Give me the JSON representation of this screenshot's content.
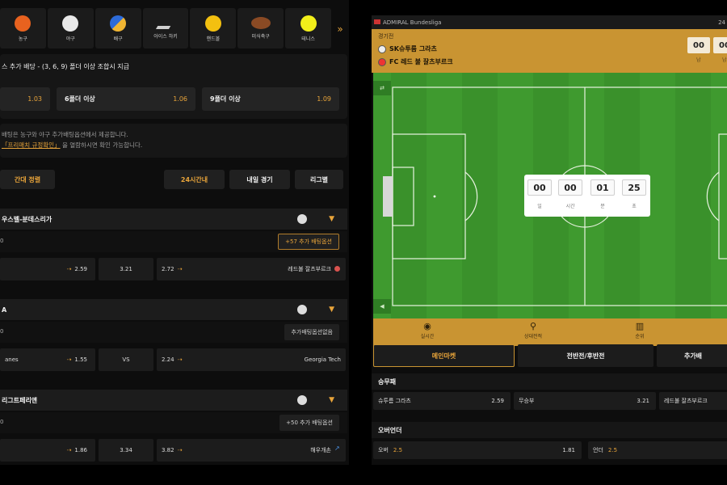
{
  "sports": [
    {
      "label": "농구",
      "icon": "basketball-icon",
      "color": "#e8621f"
    },
    {
      "label": "야구",
      "icon": "baseball-icon",
      "color": "#e9e9e9"
    },
    {
      "label": "배구",
      "icon": "volleyball-icon",
      "color": "#f0b532"
    },
    {
      "label": "아이스 하키",
      "icon": "hockey-stick-icon",
      "color": "#cfcfcf"
    },
    {
      "label": "핸드볼",
      "icon": "handball-icon",
      "color": "#f3c010"
    },
    {
      "label": "미식축구",
      "icon": "football-icon",
      "color": "#8a4a24"
    },
    {
      "label": "테니스",
      "icon": "tennis-ball-icon",
      "color": "#f2ef1a"
    }
  ],
  "sports_more": "»",
  "bonus": {
    "title": "스 추가 배당 - (3, 6, 9) 폴더 이상 조합시 지급",
    "items": [
      {
        "label": "",
        "value": "1.03"
      },
      {
        "label": "6폴더 이상",
        "value": "1.06"
      },
      {
        "label": "9폴더 이상",
        "value": "1.09"
      }
    ]
  },
  "notice": {
    "line1": "배팅은 농구와 야구 추가배팅옵션에서 제공합니다.",
    "link": "「프리매치 규정확인」",
    "line2_suffix": " 을 열람하시면 확인 가능합니다."
  },
  "sort": {
    "left": "간대 정렬",
    "buttons": [
      "24시간내",
      "내일 경기",
      "리그별"
    ]
  },
  "leagues": [
    {
      "name": "우스벨-분데스리가",
      "zero": "0",
      "extra": "+57 추가 배팅옵션",
      "home": "",
      "home_odds": "2.59",
      "draw": "3.21",
      "away_odds": "2.72",
      "away": "레드불 잘츠부르크"
    },
    {
      "name": "A",
      "zero": "0",
      "extra": "추가배팅옵션없음",
      "home": "anes",
      "home_odds": "1.55",
      "draw": "VS",
      "away_odds": "2.24",
      "away": "Georgia Tech"
    },
    {
      "name": "리그트페리앤",
      "zero": "0",
      "extra": "+50 추가 배팅옵션",
      "home": "",
      "home_odds": "1.86",
      "draw": "3.34",
      "away_odds": "3.82",
      "away": "해우개손"
    }
  ],
  "match": {
    "league": "ADMIRAL Bundesliga",
    "right_time": "24",
    "status": "경기전",
    "home": "SK슈투름 그라츠",
    "away": "FC 레드 불 잘츠부르크",
    "scores": [
      "00",
      "00"
    ],
    "score_labels": [
      "남",
      "남"
    ],
    "pitch_tabs": [
      "⇄",
      "◀"
    ],
    "timer": [
      {
        "value": "00",
        "label": "일"
      },
      {
        "value": "00",
        "label": "시간"
      },
      {
        "value": "01",
        "label": "분"
      },
      {
        "value": "25",
        "label": "초"
      }
    ],
    "view_tabs": [
      {
        "icon": "eye-icon",
        "glyph": "◉",
        "label": "실시간"
      },
      {
        "icon": "lineup-icon",
        "glyph": "⚲",
        "label": "상대전적"
      },
      {
        "icon": "stats-icon",
        "glyph": "▥",
        "label": "순위"
      }
    ],
    "market_tabs": [
      "메인마켓",
      "전반전/후반전",
      "추가배"
    ],
    "win_title": "승무패",
    "win": [
      {
        "label": "슈투름 그라츠",
        "value": "2.59"
      },
      {
        "label": "무승부",
        "value": "3.21"
      },
      {
        "label": "레드불 잘츠부르크",
        "value": "2.72"
      }
    ],
    "ou_title": "오버언더",
    "ou": [
      {
        "label": "오버",
        "line": "2.5",
        "value": "1.81"
      },
      {
        "label": "언더",
        "line": "2.5",
        "value": ""
      }
    ]
  },
  "colors": {
    "accent": "#e8a43a",
    "panel_gold": "#c99432",
    "pitch": "#3f9a2f"
  }
}
